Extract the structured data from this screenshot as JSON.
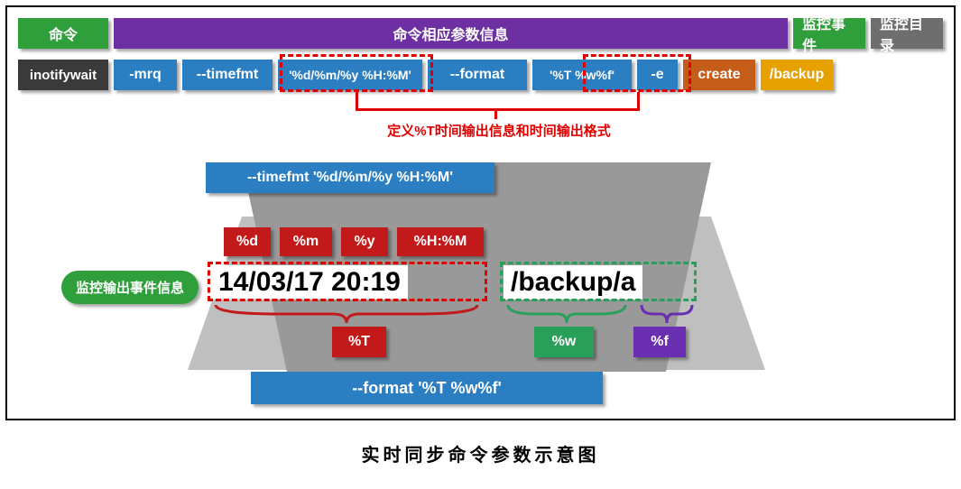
{
  "header": {
    "command": "命令",
    "param_info": "命令相应参数信息",
    "monitor_event": "监控事件",
    "monitor_dir": "监控目录"
  },
  "cmd": {
    "prog": "inotifywait",
    "opt_mrq": "-mrq",
    "opt_timefmt": "--timefmt",
    "timefmt_val": "'%d/%m/%y %H:%M'",
    "opt_format": "--format",
    "format_val": "'%T %w%f'",
    "opt_e": "-e",
    "event": "create",
    "dir": "/backup"
  },
  "note": {
    "timefmt_desc": "定义%T时间输出信息和时间输出格式",
    "output_title": "监控输出事件信息"
  },
  "detail": {
    "timefmt_full": "--timefmt '%d/%m/%y %H:%M'",
    "tokens": {
      "d": "%d",
      "m": "%m",
      "y": "%y",
      "hm": "%H:%M"
    },
    "sample_time": "14/03/17 20:19",
    "sample_path": "/backup/a",
    "fmt_T": "%T",
    "fmt_w": "%w",
    "fmt_f": "%f",
    "format_full": "--format '%T %w%f'"
  },
  "caption": "实时同步命令参数示意图"
}
